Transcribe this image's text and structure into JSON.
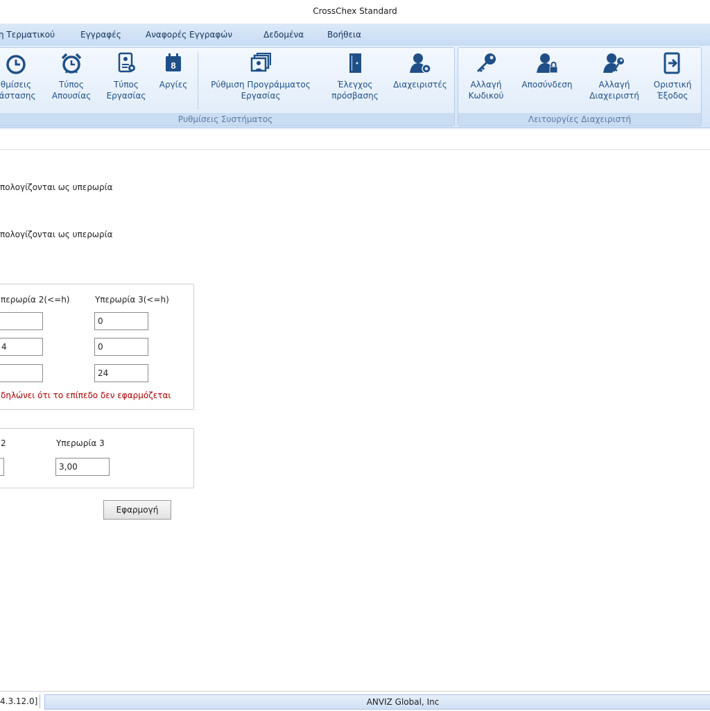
{
  "window": {
    "title": "CrossChex Standard"
  },
  "menu": [
    "η Τερματικού",
    "Εγγραφές",
    "Αναφορές Εγγραφών",
    "Δεδομένα",
    "Βοήθεια"
  ],
  "ribbon": {
    "group1": {
      "caption": "Ρυθμίσεις Συστήματος",
      "buttons": [
        {
          "line1": "θμίσεις",
          "line2": "ιάστασης",
          "icon": "clock-icon"
        },
        {
          "line1": "Τύπος",
          "line2": "Απουσίας",
          "icon": "alarm-clock-icon"
        },
        {
          "line1": "Τύπος",
          "line2": "Εργασίας",
          "icon": "work-type-icon"
        },
        {
          "line1": "Αργίες",
          "line2": "",
          "icon": "calendar-icon"
        },
        {
          "line1": "Ρύθμιση Προγράμματος",
          "line2": "Εργασίας",
          "icon": "schedule-icon"
        },
        {
          "line1": "Έλεγχος",
          "line2": "πρόσβασης",
          "icon": "door-icon"
        },
        {
          "line1": "Διαχειριστές",
          "line2": "",
          "icon": "admin-gear-icon"
        }
      ]
    },
    "group2": {
      "caption": "Λειτουργίες Διαχειριστή",
      "buttons": [
        {
          "line1": "Αλλαγή",
          "line2": "Κωδικού",
          "icon": "key-icon"
        },
        {
          "line1": "Αποσύνδεση",
          "line2": "",
          "icon": "user-lock-icon"
        },
        {
          "line1": "Αλλαγή",
          "line2": "Διαχειριστή",
          "icon": "user-key-icon"
        },
        {
          "line1": "Οριστική",
          "line2": "Έξοδος",
          "icon": "exit-icon"
        }
      ]
    }
  },
  "content": {
    "info1": "πολογίζονται ως υπερωρία",
    "info2": "πολογίζονται ως υπερωρία",
    "hours_panel": {
      "col2_header": "περωρία 2(<=h)",
      "col3_header": "Υπερωρία 3(<=h)",
      "col2_values": [
        "",
        "4",
        ""
      ],
      "col3_values": [
        "0",
        "0",
        "24"
      ],
      "note": "δηλώνει ότι το επίπεδο δεν εφαρμόζεται"
    },
    "rate_panel": {
      "col2_header": "2",
      "col3_header": "Υπερωρία 3",
      "col3_value": "3,00"
    },
    "apply_label": "Εφαρμογή"
  },
  "status": {
    "left": "4.3.12.0]",
    "center": "ANVIZ Global, Inc"
  },
  "colors": {
    "menubar": "#c7dcf4",
    "ribbon": "#d4e4f7",
    "icon": "#1f4f86",
    "note": "#a80000"
  }
}
